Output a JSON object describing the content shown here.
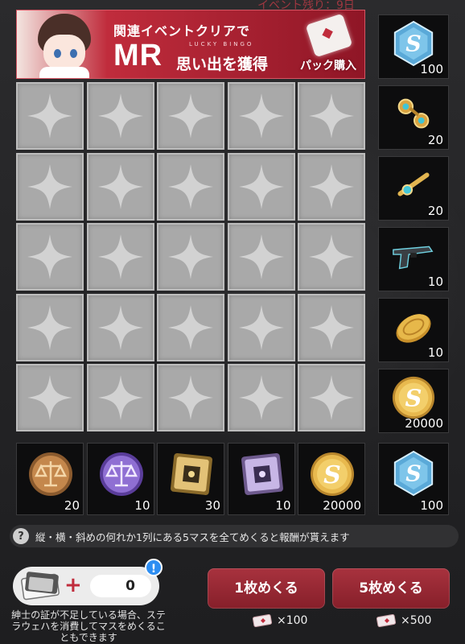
{
  "event_remaining": "イベント残り：9日",
  "banner": {
    "line1": "関連イベントクリアで",
    "mr": "MR",
    "lucky": "LUCKY BINGO",
    "line2": "思い出を獲得",
    "pack_label": "パック購入"
  },
  "side_rewards": [
    {
      "icon": "blue-s-medal-icon",
      "count": "100"
    },
    {
      "icon": "cufflinks-icon",
      "count": "20"
    },
    {
      "icon": "tie-clip-icon",
      "count": "20"
    },
    {
      "icon": "pistol-icon",
      "count": "10"
    },
    {
      "icon": "gold-coin-icon",
      "count": "10"
    },
    {
      "icon": "gold-s-coin-icon",
      "count": "20000"
    }
  ],
  "bottom_rewards": [
    {
      "icon": "bronze-scales-coin-icon",
      "count": "20"
    },
    {
      "icon": "purple-scales-coin-icon",
      "count": "10"
    },
    {
      "icon": "gold-chip-icon",
      "count": "30"
    },
    {
      "icon": "purple-chip-icon",
      "count": "10"
    },
    {
      "icon": "gold-s-coin-icon",
      "count": "20000"
    }
  ],
  "corner_reward": {
    "icon": "blue-s-medal-icon",
    "count": "100"
  },
  "hint": {
    "icon": "question-icon",
    "mark": "?",
    "text": "縦・横・斜めの何れか1列にある5マスを全てめくると報酬が貰えます"
  },
  "tickets": {
    "value": "0",
    "alert": "!",
    "note": "紳士の証が不足している場合、ステラウェハを消費してマスをめくることもできます"
  },
  "buttons": {
    "flip1": {
      "label": "1枚めくる",
      "cost": "×100"
    },
    "flip5": {
      "label": "5枚めくる",
      "cost": "×500"
    }
  },
  "colors": {
    "accent": "#c02c3c",
    "button": "#9b2935",
    "cell": "#a9a9a9"
  }
}
